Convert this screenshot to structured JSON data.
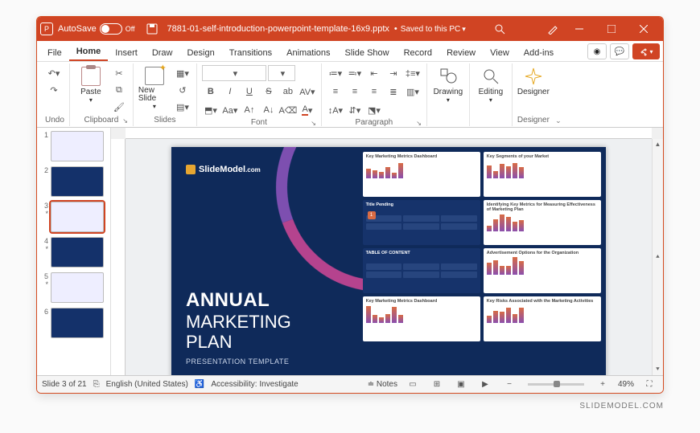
{
  "titlebar": {
    "autosave_label": "AutoSave",
    "autosave_state": "Off",
    "filename": "7881-01-self-introduction-powerpoint-template-16x9.pptx",
    "save_state": "Saved to this PC"
  },
  "tabs": [
    "File",
    "Home",
    "Insert",
    "Draw",
    "Design",
    "Transitions",
    "Animations",
    "Slide Show",
    "Record",
    "Review",
    "View",
    "Add-ins"
  ],
  "active_tab": "Home",
  "ribbon": {
    "undo_label": "Undo",
    "clipboard_label": "Clipboard",
    "paste_label": "Paste",
    "slides_label": "Slides",
    "newslide_label": "New Slide",
    "font_label": "Font",
    "paragraph_label": "Paragraph",
    "drawing_label": "Drawing",
    "editing_label": "Editing",
    "designer_label": "Designer",
    "designer_btn": "Designer"
  },
  "thumbs": [
    {
      "n": "1"
    },
    {
      "n": "2"
    },
    {
      "n": "3",
      "star": "*"
    },
    {
      "n": "4",
      "star": "*"
    },
    {
      "n": "5",
      "star": "*"
    },
    {
      "n": "6"
    }
  ],
  "current_slide_index": 2,
  "slide": {
    "brand": "SlideModel",
    "brand_suffix": ".com",
    "h1": "ANNUAL",
    "h2a": "MARKETING",
    "h2b": "PLAN",
    "sub": "PRESENTATION TEMPLATE",
    "minis": [
      {
        "title": "Key Marketing Metrics Dashboard",
        "variant": "light"
      },
      {
        "title": "Key Segments of your Market",
        "variant": "light"
      },
      {
        "title": "Title Pending",
        "variant": "dark",
        "badge": "1"
      },
      {
        "title": "Identifying Key Metrics for Measuring Effectiveness of Marketing Plan",
        "variant": "light"
      },
      {
        "title": "TABLE OF CONTENT",
        "variant": "dark"
      },
      {
        "title": "Advertisement Options for the Organization",
        "variant": "light"
      },
      {
        "title": "Key Marketing Metrics Dashboard",
        "variant": "light"
      },
      {
        "title": "Key Risks Associated with the Marketing Activities",
        "variant": "light"
      }
    ]
  },
  "status": {
    "slide_counter": "Slide 3 of 21",
    "language": "English (United States)",
    "accessibility": "Accessibility: Investigate",
    "notes": "Notes",
    "zoom": "49%"
  },
  "attribution": "SLIDEMODEL.COM"
}
